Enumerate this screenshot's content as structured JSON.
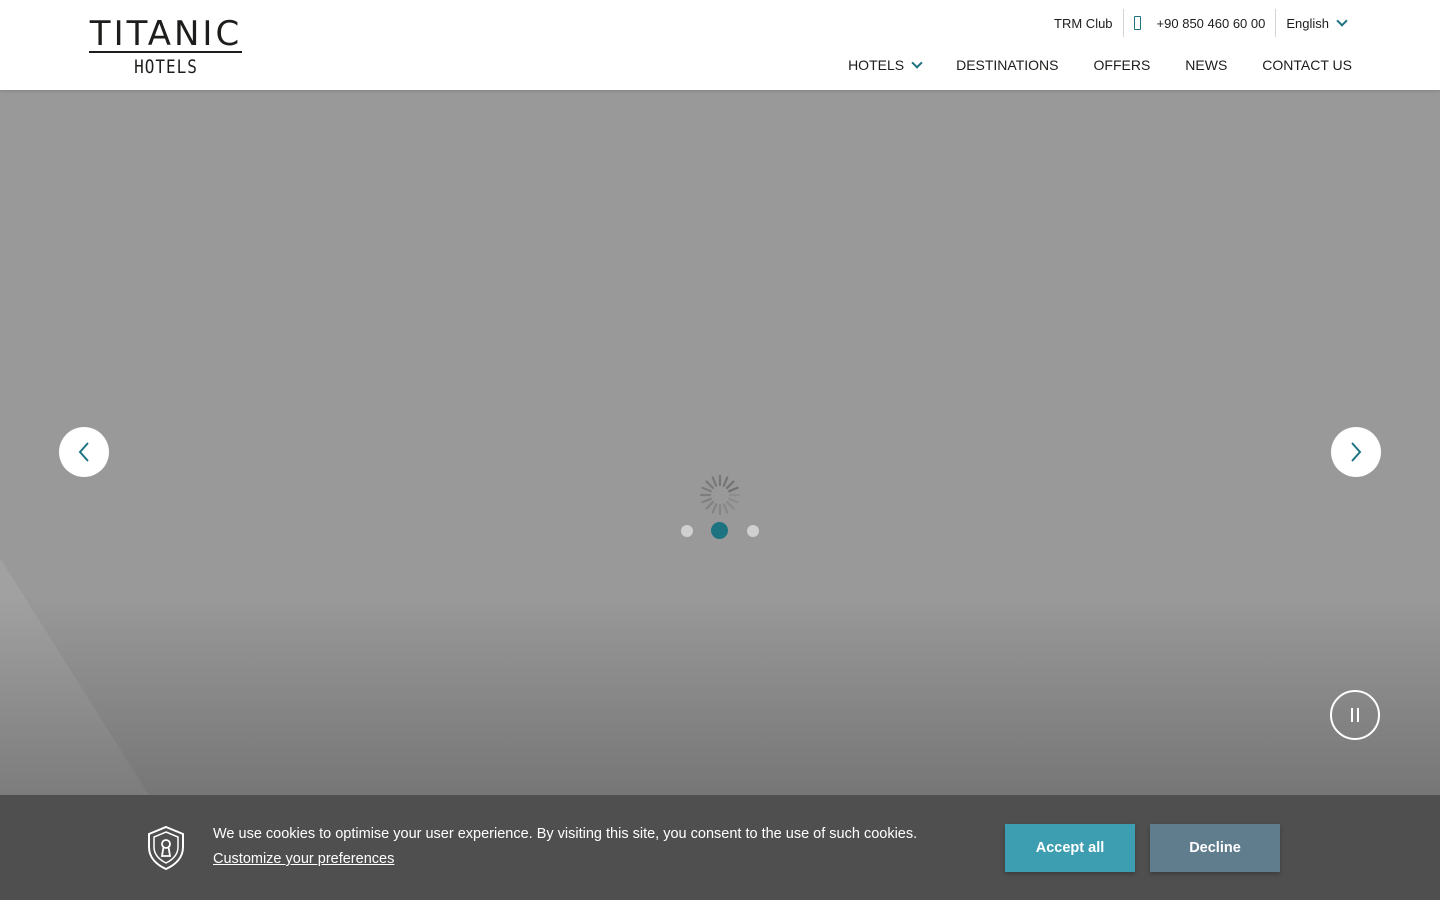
{
  "header": {
    "logo_main": "TITANIC",
    "logo_sub": "HOTELS",
    "topbar": {
      "club": "TRM Club",
      "phone": "+90 850 460 60 00",
      "language": "English"
    },
    "nav": {
      "hotels": "HOTELS",
      "destinations": "DESTINATIONS",
      "offers": "OFFERS",
      "news": "NEWS",
      "contact": "CONTACT US"
    }
  },
  "hero": {
    "slide_count": 3,
    "active_slide": 2,
    "state": "loading"
  },
  "cookie": {
    "text": "We use cookies to optimise your user experience. By visiting this site, you consent to the use of such cookies. ",
    "link": "Customize your preferences",
    "accept": "Accept all",
    "decline": "Decline"
  },
  "colors": {
    "accent": "#1e7380",
    "accept_button": "#3d9db1",
    "decline_button": "#5f7d8c",
    "cookie_bar": "#4f4f4f",
    "hero_placeholder": "#999999"
  },
  "icons": {
    "phone": "phone-icon",
    "language_dropdown": "chevron-down-icon",
    "hotels_dropdown": "chevron-down-icon",
    "prev": "chevron-left-icon",
    "next": "chevron-right-icon",
    "loader": "spinner-icon",
    "pause": "pause-icon",
    "cookie": "shield-lock-icon"
  }
}
